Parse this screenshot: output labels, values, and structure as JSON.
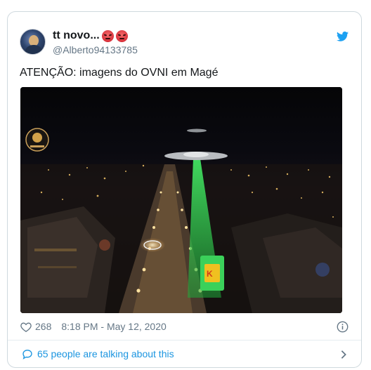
{
  "tweet": {
    "author_name": "tt novo...",
    "author_handle": "@Alberto94133785",
    "text": "ATENÇÃO: imagens do OVNI em Magé",
    "likes": "268",
    "timestamp": "8:18 PM - May 12, 2020",
    "talking_text": "65 people are talking about this"
  },
  "icons": {
    "brand": "twitter-bird-icon",
    "emoji": "angry-face-emoji",
    "like": "heart-icon",
    "info": "info-icon",
    "reply": "chat-bubble-icon",
    "more": "chevron-right-icon"
  },
  "colors": {
    "twitter_blue": "#1da1f2",
    "link_blue": "#1b95e0",
    "meta_gray": "#657786",
    "ufo_beam_green": "#32e05a"
  }
}
